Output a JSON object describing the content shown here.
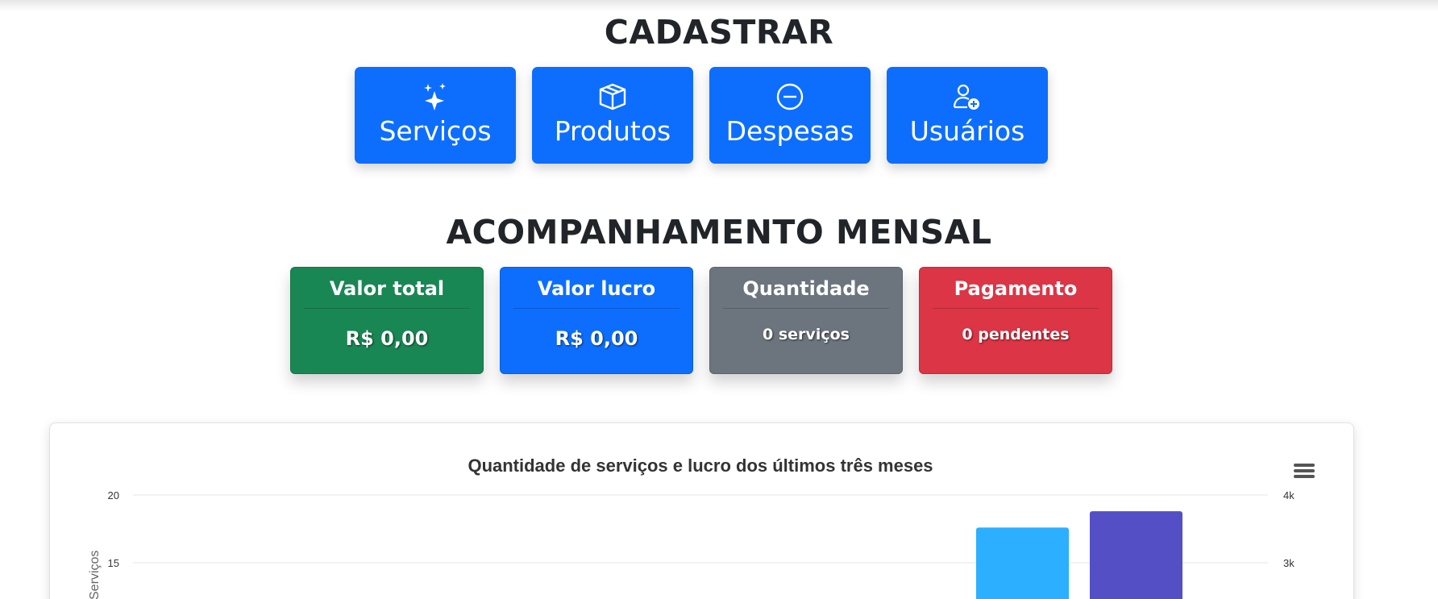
{
  "register": {
    "title": "CADASTRAR",
    "buttons": [
      {
        "label": "Serviços",
        "icon": "sparkles-icon"
      },
      {
        "label": "Produtos",
        "icon": "box-icon"
      },
      {
        "label": "Despesas",
        "icon": "minus-circle-icon"
      },
      {
        "label": "Usuários",
        "icon": "user-plus-icon"
      }
    ]
  },
  "monthly": {
    "title": "ACOMPANHAMENTO MENSAL",
    "cards": [
      {
        "title": "Valor total",
        "value": "R$ 0,00",
        "color": "#198754"
      },
      {
        "title": "Valor lucro",
        "value": "R$ 0,00",
        "color": "#0d6efd"
      },
      {
        "title": "Quantidade",
        "value": "0 serviços",
        "color": "#6c757d"
      },
      {
        "title": "Pagamento",
        "value": "0 pendentes",
        "color": "#dc3545"
      }
    ]
  },
  "colors": {
    "primary": "#0d6efd",
    "bar1": "#2caffe",
    "bar2": "#544fc5"
  },
  "chart_data": {
    "type": "bar",
    "title": "Quantidade de serviços e lucro dos últimos três meses",
    "ylabel": "Serviços",
    "y_ticks": [
      "20",
      "15"
    ],
    "y2_ticks": [
      "4k",
      "3k"
    ],
    "ylim": [
      0,
      20
    ],
    "y2lim": [
      0,
      4000
    ],
    "grid": true,
    "series": [
      {
        "values": [
          17.6
        ],
        "axis": "left",
        "color": "#2caffe"
      },
      {
        "values": [
          3760
        ],
        "axis": "right",
        "color": "#544fc5"
      }
    ]
  }
}
